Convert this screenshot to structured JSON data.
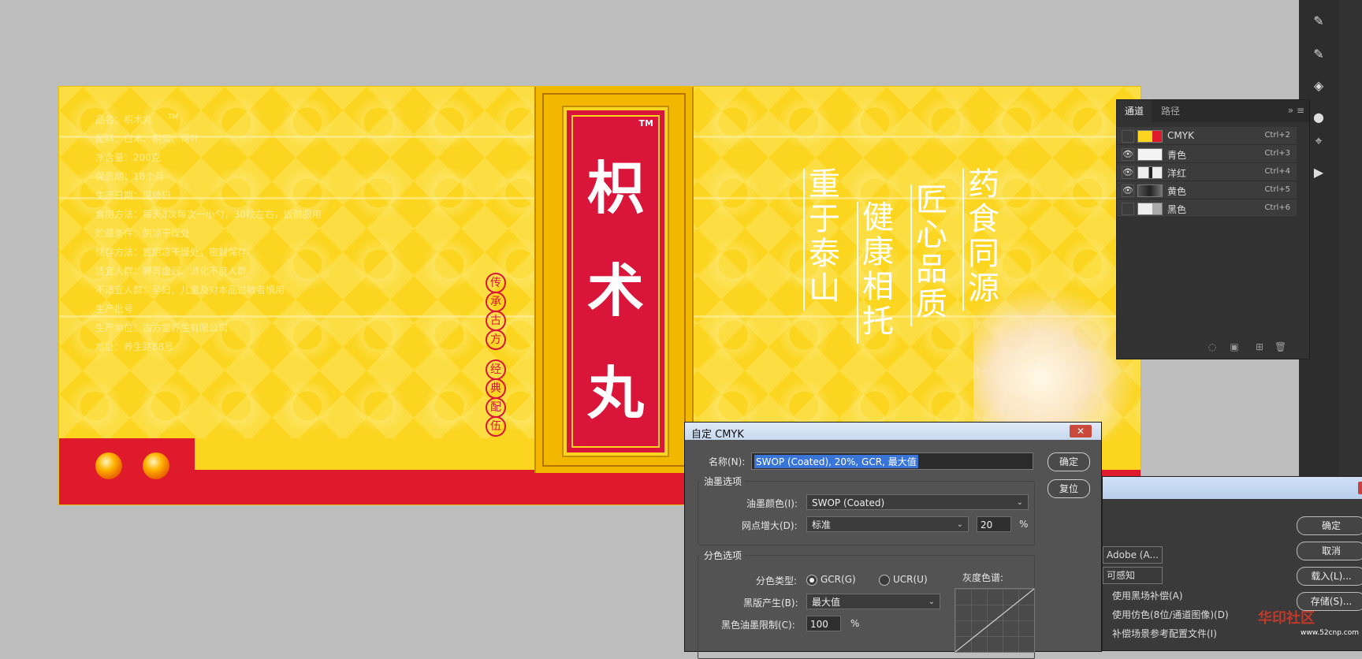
{
  "artwork": {
    "info_lines": [
      "品名：枳术丸",
      "配料：白术、枳实、荷叶",
      "净含量：200克",
      "保质期：18个月",
      "生产日期：见喷码",
      "食用方法：每天3次每次一小勺，30粒左右，饭前服用",
      "贮藏条件：阴凉干燥处",
      "储存方法：置阴凉干燥处，密封保存",
      "适宜人群：脾胃虚弱、消化不良人群",
      "不适宜人群：孕妇、儿童及对本品过敏者慎用",
      "生产批号",
      "生产单位：古方堂养生有限公司",
      "地址：养生路88号"
    ],
    "tm_small": "TM",
    "tm_big": "TM",
    "product_chars": [
      "枳",
      "术",
      "丸"
    ],
    "seal_left": [
      "传",
      "承",
      "古",
      "方"
    ],
    "seal_right": [
      "经",
      "典",
      "配",
      "伍"
    ],
    "slogans": [
      [
        "重",
        "于",
        "泰",
        "山"
      ],
      [
        "健",
        "康",
        "相",
        "托"
      ],
      [
        "匠",
        "心",
        "品",
        "质"
      ],
      [
        "药",
        "食",
        "同",
        "源"
      ]
    ],
    "colors": {
      "background": "#fbd520",
      "red": "#e01a2d",
      "panel": "#d9163a"
    }
  },
  "channels_panel": {
    "tabs": [
      "通道",
      "路径"
    ],
    "active_tab": "通道",
    "rows": [
      {
        "name": "CMYK",
        "shortcut": "Ctrl+2",
        "visible": false
      },
      {
        "name": "青色",
        "shortcut": "Ctrl+3",
        "visible": true
      },
      {
        "name": "洋红",
        "shortcut": "Ctrl+4",
        "visible": true
      },
      {
        "name": "黄色",
        "shortcut": "Ctrl+5",
        "visible": true
      },
      {
        "name": "黑色",
        "shortcut": "Ctrl+6",
        "visible": false
      }
    ]
  },
  "cmyk_dialog": {
    "title": "自定 CMYK",
    "name_label": "名称(N):",
    "name_value": "SWOP (Coated), 20%, GCR, 最大值",
    "ok": "确定",
    "reset": "复位",
    "ink_group": "油墨选项",
    "ink_color_label": "油墨颜色(I):",
    "ink_color_value": "SWOP (Coated)",
    "dot_gain_label": "网点增大(D):",
    "dot_gain_mode": "标准",
    "dot_gain_value": "20",
    "percent": "%",
    "sep_group": "分色选项",
    "sep_type_label": "分色类型:",
    "gcr": "GCR(G)",
    "ucr": "UCR(U)",
    "gray_ramp": "灰度色谱:",
    "black_gen_label": "黑版产生(B):",
    "black_gen_value": "最大值",
    "black_limit_label": "黑色油墨限制(C):",
    "black_limit_value": "100"
  },
  "bg_dialog": {
    "buttons": [
      "确定",
      "取消",
      "载入(L)...",
      "存储(S)..."
    ],
    "select1": "Adobe (A...",
    "select2": "可感知",
    "check1": "使用黑场补偿(A)",
    "check2": "使用仿色(8位/通道图像)(D)",
    "check3": "补偿场景参考配置文件(I)"
  },
  "watermark": {
    "text": "华印社区",
    "sub": "www.52cnp.com"
  }
}
